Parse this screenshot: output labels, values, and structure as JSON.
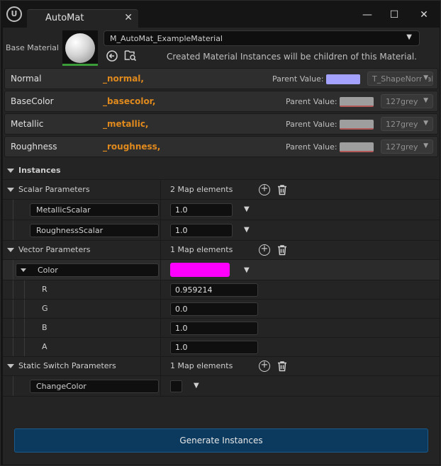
{
  "window": {
    "tab_title": "AutoMat",
    "close_glyph": "✕",
    "controls": {
      "minimize": "—",
      "maximize": "☐",
      "close": "✕"
    }
  },
  "base_material": {
    "label": "Base Material",
    "material_name": "M_AutoMat_ExampleMaterial",
    "hint": "Created Material Instances will be children of this Material."
  },
  "channels": [
    {
      "name": "Normal",
      "suffix": "_normal,",
      "parent_label": "Parent Value:",
      "swatch_color": "#a3a3ff",
      "texture": "T_ShapeNormal"
    },
    {
      "name": "BaseColor",
      "suffix": "_basecolor,",
      "parent_label": "Parent Value:",
      "swatch_color": "#9e9e9e",
      "texture": "127grey"
    },
    {
      "name": "Metallic",
      "suffix": "_metallic,",
      "parent_label": "Parent Value:",
      "swatch_color": "#9e9e9e",
      "texture": "127grey"
    },
    {
      "name": "Roughness",
      "suffix": "_roughness,",
      "parent_label": "Parent Value:",
      "swatch_color": "#9e9e9e",
      "texture": "127grey"
    }
  ],
  "instances": {
    "title": "Instances",
    "scalar": {
      "title": "Scalar Parameters",
      "count": "2 Map elements",
      "items": [
        {
          "key": "MetallicScalar",
          "value": "1.0"
        },
        {
          "key": "RoughnessScalar",
          "value": "1.0"
        }
      ]
    },
    "vector": {
      "title": "Vector Parameters",
      "count": "1 Map elements",
      "item_key": "Color",
      "item_color": "#ff00ff",
      "components": [
        {
          "label": "R",
          "value": "0.959214"
        },
        {
          "label": "G",
          "value": "0.0"
        },
        {
          "label": "B",
          "value": "1.0"
        },
        {
          "label": "A",
          "value": "1.0"
        }
      ]
    },
    "static_switch": {
      "title": "Static Switch Parameters",
      "count": "1 Map elements",
      "item_key": "ChangeColor",
      "checked": false
    }
  },
  "generate_button": "Generate Instances",
  "colors": {
    "accent_orange": "#e08a1e",
    "button_blue": "#0c3a5e",
    "thumbnail_green": "#3a9d3a"
  }
}
